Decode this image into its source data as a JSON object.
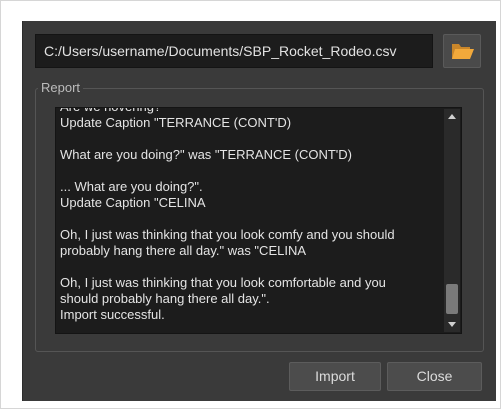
{
  "file_path": "C:/Users/username/Documents/SBP_Rocket_Rodeo.csv",
  "browse_icon": "folder-open-icon",
  "report": {
    "label": "Report",
    "lines": [
      "Are we hovering?\"",
      "Update Caption  \"TERRANCE (CONT'D)",
      "",
      "What are you doing?\" was \"TERRANCE (CONT'D)",
      "",
      "... What are you doing?\".",
      "Update Caption  \"CELINA",
      "",
      "Oh, I just was thinking that you look comfy and you should",
      "probably hang there all day.\" was \"CELINA",
      "",
      "Oh, I just was thinking that you look comfortable and you",
      "should probably hang there all day.\".",
      "Import successful."
    ]
  },
  "buttons": {
    "import": "Import",
    "close": "Close"
  },
  "colors": {
    "dialog_bg": "#3a3a3a",
    "field_bg": "#1c1c1c",
    "folder_icon": "#f2a93b"
  }
}
